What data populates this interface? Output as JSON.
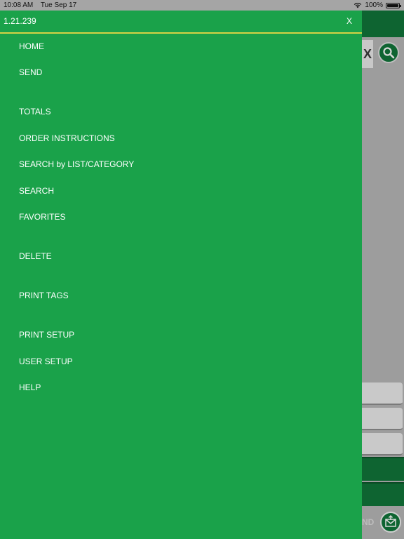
{
  "status_bar": {
    "time": "10:08 AM",
    "date": "Tue Sep 17",
    "wifi_icon": "wifi-icon",
    "battery_percent": "100%"
  },
  "drawer": {
    "version": "1.21.239",
    "close_label": "X",
    "menu": [
      {
        "label": "HOME"
      },
      {
        "label": "SEND"
      },
      {
        "label": "TOTALS"
      },
      {
        "label": "ORDER INSTRUCTIONS"
      },
      {
        "label": "SEARCH by LIST/CATEGORY"
      },
      {
        "label": "SEARCH"
      },
      {
        "label": "FAVORITES"
      },
      {
        "label": "DELETE"
      },
      {
        "label": "PRINT TAGS"
      },
      {
        "label": "PRINT SETUP"
      },
      {
        "label": "USER SETUP"
      },
      {
        "label": "HELP"
      }
    ]
  },
  "background_app": {
    "clear_label": "X",
    "send_label": "ND",
    "colors": {
      "drawer_green": "#1aa24a",
      "dark_green": "#0e6431",
      "header_divider": "#d6d245"
    }
  }
}
